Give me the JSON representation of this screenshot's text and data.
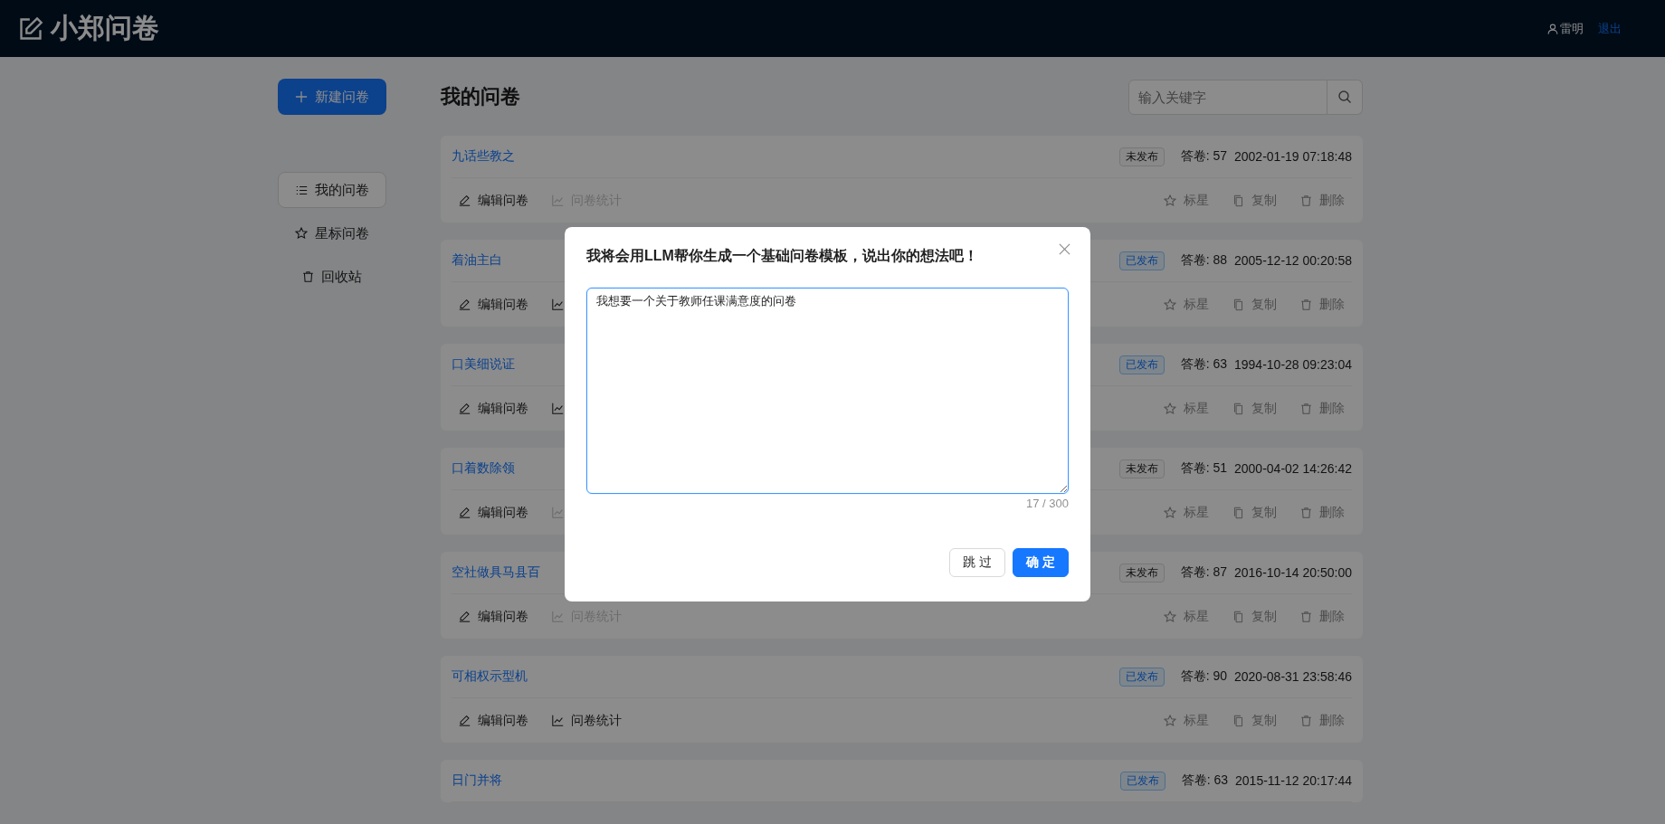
{
  "header": {
    "logo": "小郑问卷",
    "user": "雷明",
    "logout": "退出"
  },
  "sidebar": {
    "create_button": "新建问卷",
    "items": [
      {
        "label": "我的问卷",
        "selected": true,
        "kind": "list"
      },
      {
        "label": "星标问卷",
        "selected": false,
        "kind": "star"
      },
      {
        "label": "回收站",
        "selected": false,
        "kind": "trash"
      }
    ]
  },
  "main": {
    "title": "我的问卷",
    "search": {
      "placeholder": "输入关键字"
    },
    "questionnaires": [
      {
        "title": "九话些教之",
        "published": false,
        "status": "未发布",
        "answers": "答卷: 57",
        "created": "2002-01-19 07:18:48",
        "edit": "编辑问卷",
        "stats": {
          "label": "问卷统计",
          "disabled": true
        },
        "star": "标星",
        "copy": "复制",
        "delete": "删除"
      },
      {
        "title": "着油主白",
        "published": true,
        "status": "已发布",
        "answers": "答卷: 88",
        "created": "2005-12-12 00:20:58",
        "edit": "编辑问卷",
        "stats": {
          "disabled": false
        },
        "star": "标星",
        "copy": "复制",
        "delete": "删除"
      },
      {
        "title": "口美细说证",
        "published": true,
        "status": "已发布",
        "answers": "答卷: 63",
        "created": "1994-10-28 09:23:04",
        "edit": "编辑问卷",
        "stats": {
          "disabled": false
        },
        "star": "标星",
        "copy": "复制",
        "delete": "删除"
      },
      {
        "title": "口着数除领",
        "published": false,
        "status": "未发布",
        "answers": "答卷: 51",
        "created": "2000-04-02 14:26:42",
        "edit": "编辑问卷",
        "stats": {
          "disabled": true
        },
        "star": "标星",
        "copy": "复制",
        "delete": "删除"
      },
      {
        "title": "空社做具马县百",
        "published": false,
        "status": "未发布",
        "answers": "答卷: 87",
        "created": "2016-10-14 20:50:00",
        "edit": "编辑问卷",
        "stats": {
          "label": "问卷统计",
          "disabled": true
        },
        "star": "标星",
        "copy": "复制",
        "delete": "删除"
      },
      {
        "title": "可相权示型机",
        "published": true,
        "status": "已发布",
        "answers": "答卷: 90",
        "created": "2020-08-31 23:58:46",
        "edit": "编辑问卷",
        "stats": {
          "label": "问卷统计",
          "disabled": false
        },
        "star": "标星",
        "copy": "复制",
        "delete": "删除"
      },
      {
        "title": "日门并将",
        "published": true,
        "status": "已发布",
        "answers": "答卷: 63",
        "created": "2015-11-12 20:17:44"
      }
    ]
  },
  "modal": {
    "title": "我将会用LLM帮你生成一个基础问卷模板，说出你的想法吧！",
    "value": "我想要一个关于教师任课满意度的问卷",
    "count": "17 / 300",
    "buttons": [
      {
        "label": "跳 过",
        "kind": "default"
      },
      {
        "label": "确 定",
        "kind": "primary"
      }
    ]
  }
}
